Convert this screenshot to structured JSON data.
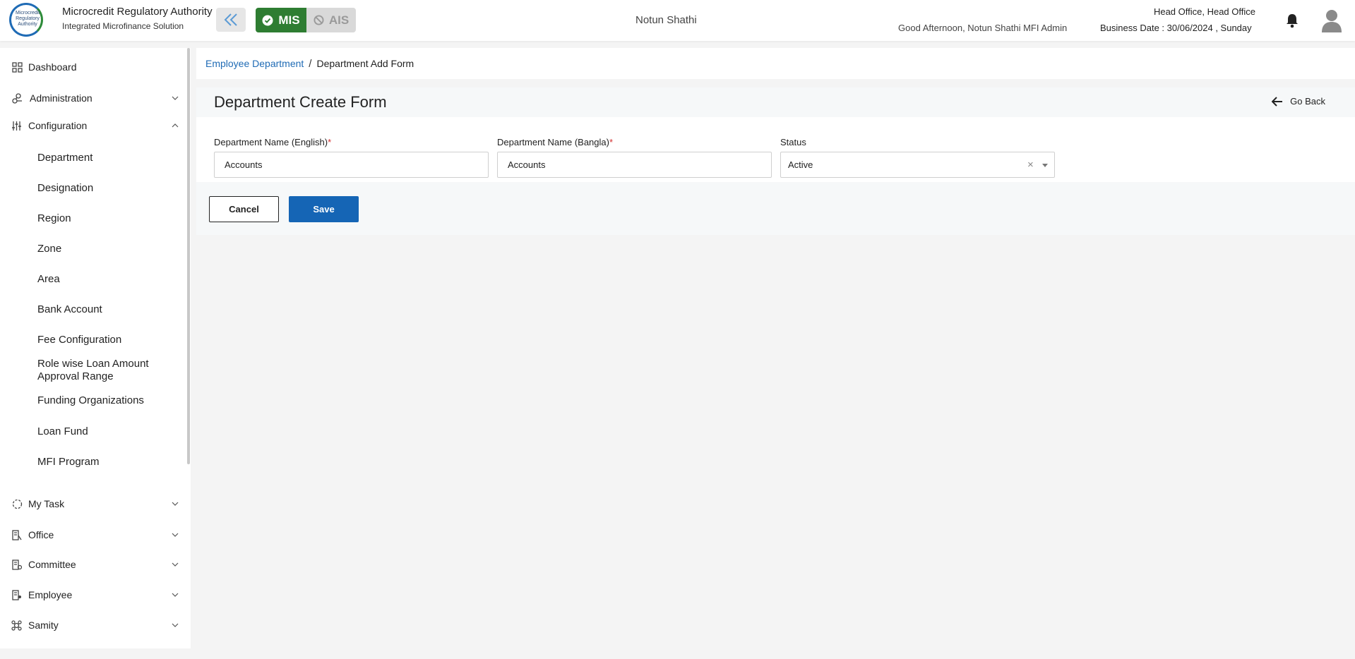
{
  "header": {
    "logo_text": "Microcredit Regulatory Authority",
    "org_name": "Microcredit Regulatory Authority",
    "org_sub": "Integrated Microfinance Solution",
    "mode_mis": "MIS",
    "mode_ais": "AIS",
    "center_title": "Notun Shathi",
    "greeting": "Good Afternoon, Notun Shathi MFI Admin",
    "office": "Head Office, Head Office",
    "business_date": "Business Date : 30/06/2024 , Sunday"
  },
  "sidebar": {
    "items": [
      {
        "label": "Dashboard",
        "icon": "grid-icon"
      },
      {
        "label": "Administration",
        "icon": "admin-icon"
      },
      {
        "label": "Configuration",
        "icon": "sliders-icon"
      },
      {
        "label": "My Task",
        "icon": "task-icon"
      },
      {
        "label": "Office",
        "icon": "office-icon"
      },
      {
        "label": "Committee",
        "icon": "committee-icon"
      },
      {
        "label": "Employee",
        "icon": "employee-icon"
      },
      {
        "label": "Samity",
        "icon": "samity-icon"
      }
    ],
    "sub_items": [
      "Department",
      "Designation",
      "Region",
      "Zone",
      "Area",
      "Bank Account",
      "Fee Configuration",
      "Role wise Loan Amount Approval Range",
      "Funding Organizations",
      "Loan Fund",
      "MFI Program"
    ]
  },
  "breadcrumb": {
    "parent": "Employee Department",
    "separator": "/",
    "current": "Department Add Form"
  },
  "form": {
    "title": "Department Create Form",
    "go_back": "Go Back",
    "fields": {
      "name_en": {
        "label": "Department Name (English)",
        "required": "*",
        "value": "Accounts"
      },
      "name_bn": {
        "label": "Department Name (Bangla)",
        "required": "*",
        "value": "Accounts"
      },
      "status": {
        "label": "Status",
        "value": "Active",
        "clear": "×"
      }
    },
    "cancel_label": "Cancel",
    "save_label": "Save"
  },
  "colors": {
    "mis_active": "#2e7d32",
    "primary": "#1565b5",
    "link": "#1f6bb5",
    "required": "#d32f2f"
  }
}
